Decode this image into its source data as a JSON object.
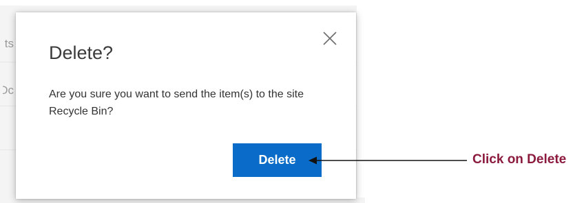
{
  "background": {
    "list_fragments": [
      "ts",
      "Dc"
    ]
  },
  "dialog": {
    "title": "Delete?",
    "message": "Are you sure you want to send the item(s) to the site Recycle Bin?",
    "close_icon": "close-icon",
    "delete_label": "Delete",
    "accent_color": "#0a6cc8"
  },
  "annotation": {
    "label": "Click on Delete",
    "label_color": "#8b1a3d",
    "arrow_icon": "arrow-left-icon"
  }
}
